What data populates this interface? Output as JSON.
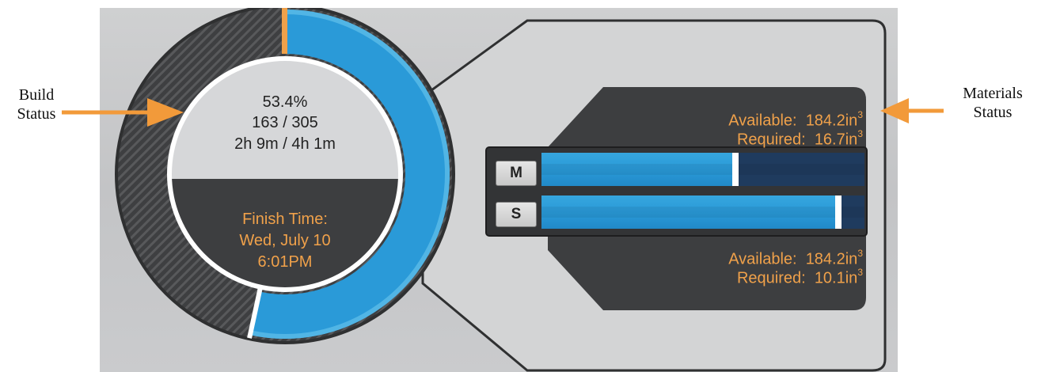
{
  "annotations": {
    "build": {
      "line1": "Build",
      "line2": "Status"
    },
    "materials": {
      "line1": "Materials",
      "line2": "Status"
    }
  },
  "build": {
    "percent_text": "53.4%",
    "layers_text": "163 / 305",
    "time_text": "2h 9m / 4h 1m",
    "progress_fraction": 0.534,
    "finish": {
      "label": "Finish Time:",
      "date": "Wed, July 10",
      "time": "6:01PM"
    }
  },
  "materials": {
    "model": {
      "button_label": "M",
      "available_label": "Available:",
      "available_value": "184.2in",
      "available_unit_exp": "3",
      "required_label": "Required:",
      "required_value": "16.7in",
      "required_unit_exp": "3",
      "level_fraction": 0.6
    },
    "support": {
      "button_label": "S",
      "available_label": "Available:",
      "available_value": "184.2in",
      "available_unit_exp": "3",
      "required_label": "Required:",
      "required_value": "10.1in",
      "required_unit_exp": "3",
      "level_fraction": 0.92
    }
  },
  "colors": {
    "accent_orange": "#f0a14a",
    "progress_blue": "#2a9ad8",
    "dark_panel": "#3d3e40",
    "bar_empty": "#1f3b5e"
  }
}
